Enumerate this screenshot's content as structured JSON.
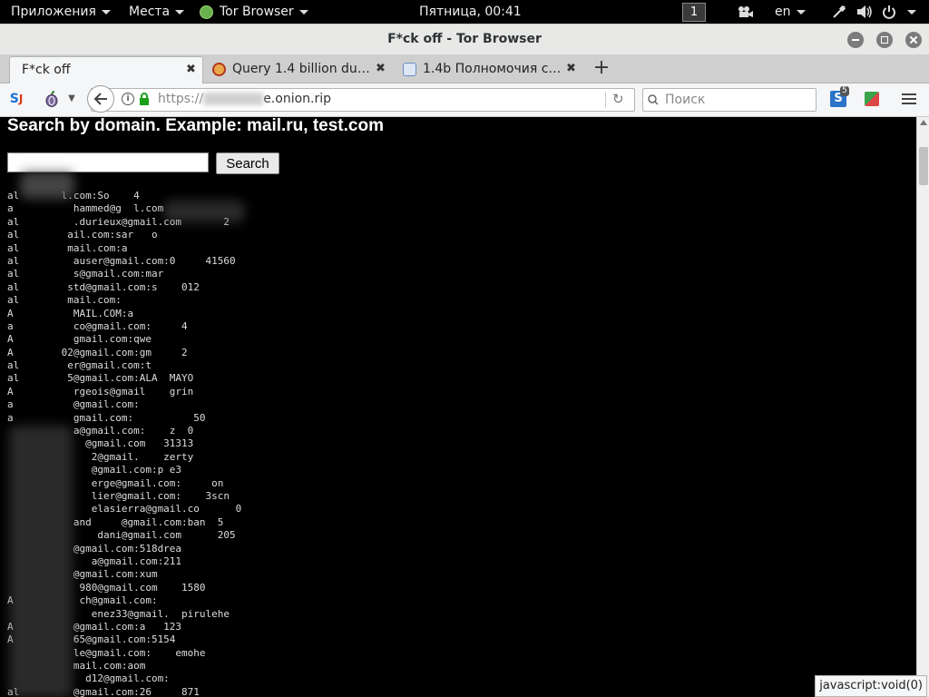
{
  "topbar": {
    "applications": "Приложения",
    "places": "Места",
    "app": "Tor Browser",
    "clock": "Пятница, 00:41",
    "workspace": "1",
    "language": "en"
  },
  "window": {
    "title": "F*ck off - Tor Browser"
  },
  "tabs": [
    {
      "label": "F*ck off",
      "active": true
    },
    {
      "label": "Query 1.4 billion du…",
      "active": false
    },
    {
      "label": "1.4b Полномочия с…",
      "active": false
    }
  ],
  "navbar": {
    "url_scheme": "https://",
    "url_tail": "e.onion.rip",
    "search_placeholder": "Поиск",
    "addon_badge": "5"
  },
  "page": {
    "heading": "Search by domain. Example: mail.ru, test.com",
    "search_button": "Search",
    "search_value": "",
    "results": [
      "al       l.com:So    4",
      "a          hammed@g  l.com",
      "al         .durieux@gmail.com       2",
      "al        ail.com:sar   o",
      "al        mail.com:a",
      "al         auser@gmail.com:0     41560",
      "al         s@gmail.com:mar",
      "al        std@gmail.com:s    012",
      "al        mail.com:",
      "A          MAIL.COM:a",
      "a          co@gmail.com:     4",
      "A          gmail.com:qwe",
      "A        02@gmail.com:gm     2",
      "al        er@gmail.com:t",
      "al        5@gmail.com:ALA  MAYO",
      "A          rgeois@gmail    grin",
      "a          @gmail.com:",
      "a          gmail.com:          50",
      "           a@gmail.com:    z  0",
      "             @gmail.com   31313",
      "              2@gmail.    zerty",
      "              @gmail.com:p e3",
      "              erge@gmail.com:     on",
      "              lier@gmail.com:    3scn",
      "              elasierra@gmail.co      0",
      "           and     @gmail.com:ban  5",
      "               dani@gmail.com      205",
      "           @gmail.com:518drea",
      "              a@gmail.com:211",
      "           @gmail.com:xum",
      "            980@gmail.com    1580",
      "A           ch@gmail.com:",
      "              enez33@gmail.  pirulehe",
      "A          @gmail.com:a   123",
      "A          65@gmail.com:5154",
      "           le@gmail.com:    emohe",
      "           mail.com:aom",
      "             d12@gmail.com:",
      "al         @gmail.com:26     871"
    ]
  },
  "status_text": "javascript:void(0)"
}
